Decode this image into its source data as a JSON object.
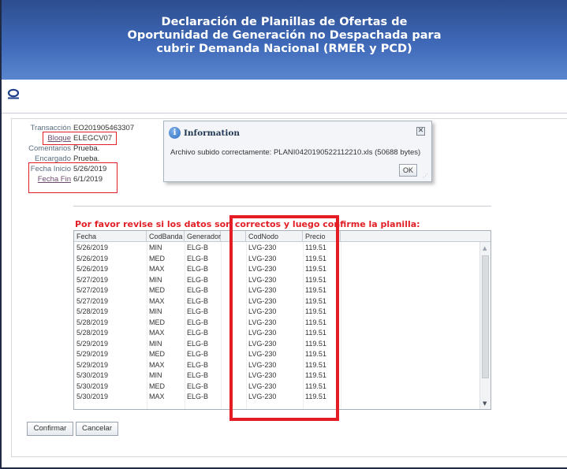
{
  "header": {
    "title_line1": "Declaración de Planillas de Ofertas de",
    "title_line2": "Oportunidad de Generación no Despachada para",
    "title_line3": "cubrir Demanda Nacional (RMER y PCD)"
  },
  "logo": {
    "icon": "oracle-ring-icon",
    "color": "#1f3f8a"
  },
  "fields": [
    {
      "label": "Transacción",
      "value": "EO201905463307"
    },
    {
      "label": "Bloque",
      "value": "ELEGCV07"
    },
    {
      "label": "Comentarios",
      "value": "Prueba."
    },
    {
      "label": "Encargado",
      "value": "Prueba."
    },
    {
      "label": "Fecha Inicio",
      "value": "5/26/2019"
    },
    {
      "label": "Fecha Fin",
      "value": "6/1/2019"
    }
  ],
  "dialog": {
    "title": "Information",
    "message": "Archivo subido correctamente: PLANI0420190522112210.xls (50688 bytes)",
    "ok_label": "OK",
    "close_glyph": "✕",
    "info_glyph": "i",
    "grip_glyph": "⋰"
  },
  "instruction": "Por favor revise si los datos son correctos y luego confirme la planilla:",
  "table": {
    "columns": [
      "Fecha",
      "CodBanda",
      "Generador",
      "CodNodo",
      "Precio"
    ],
    "rows": [
      [
        "5/26/2019",
        "MIN",
        "ELG-B",
        "LVG-230",
        "119.51"
      ],
      [
        "5/26/2019",
        "MED",
        "ELG-B",
        "LVG-230",
        "119.51"
      ],
      [
        "5/26/2019",
        "MAX",
        "ELG-B",
        "LVG-230",
        "119.51"
      ],
      [
        "5/27/2019",
        "MIN",
        "ELG-B",
        "LVG-230",
        "119.51"
      ],
      [
        "5/27/2019",
        "MED",
        "ELG-B",
        "LVG-230",
        "119.51"
      ],
      [
        "5/27/2019",
        "MAX",
        "ELG-B",
        "LVG-230",
        "119.51"
      ],
      [
        "5/28/2019",
        "MIN",
        "ELG-B",
        "LVG-230",
        "119.51"
      ],
      [
        "5/28/2019",
        "MED",
        "ELG-B",
        "LVG-230",
        "119.51"
      ],
      [
        "5/28/2019",
        "MAX",
        "ELG-B",
        "LVG-230",
        "119.51"
      ],
      [
        "5/29/2019",
        "MIN",
        "ELG-B",
        "LVG-230",
        "119.51"
      ],
      [
        "5/29/2019",
        "MED",
        "ELG-B",
        "LVG-230",
        "119.51"
      ],
      [
        "5/29/2019",
        "MAX",
        "ELG-B",
        "LVG-230",
        "119.51"
      ],
      [
        "5/30/2019",
        "MIN",
        "ELG-B",
        "LVG-230",
        "119.51"
      ],
      [
        "5/30/2019",
        "MED",
        "ELG-B",
        "LVG-230",
        "119.51"
      ],
      [
        "5/30/2019",
        "MAX",
        "ELG-B",
        "LVG-230",
        "119.51"
      ]
    ],
    "scroll_up_glyph": "▲",
    "scroll_down_glyph": "▼"
  },
  "buttons": {
    "confirm": "Confirmar",
    "cancel": "Cancelar"
  },
  "colors": {
    "header_bg": "#3f69b8",
    "highlight_red": "#e21f26",
    "instruction_red": "#e21f26"
  }
}
